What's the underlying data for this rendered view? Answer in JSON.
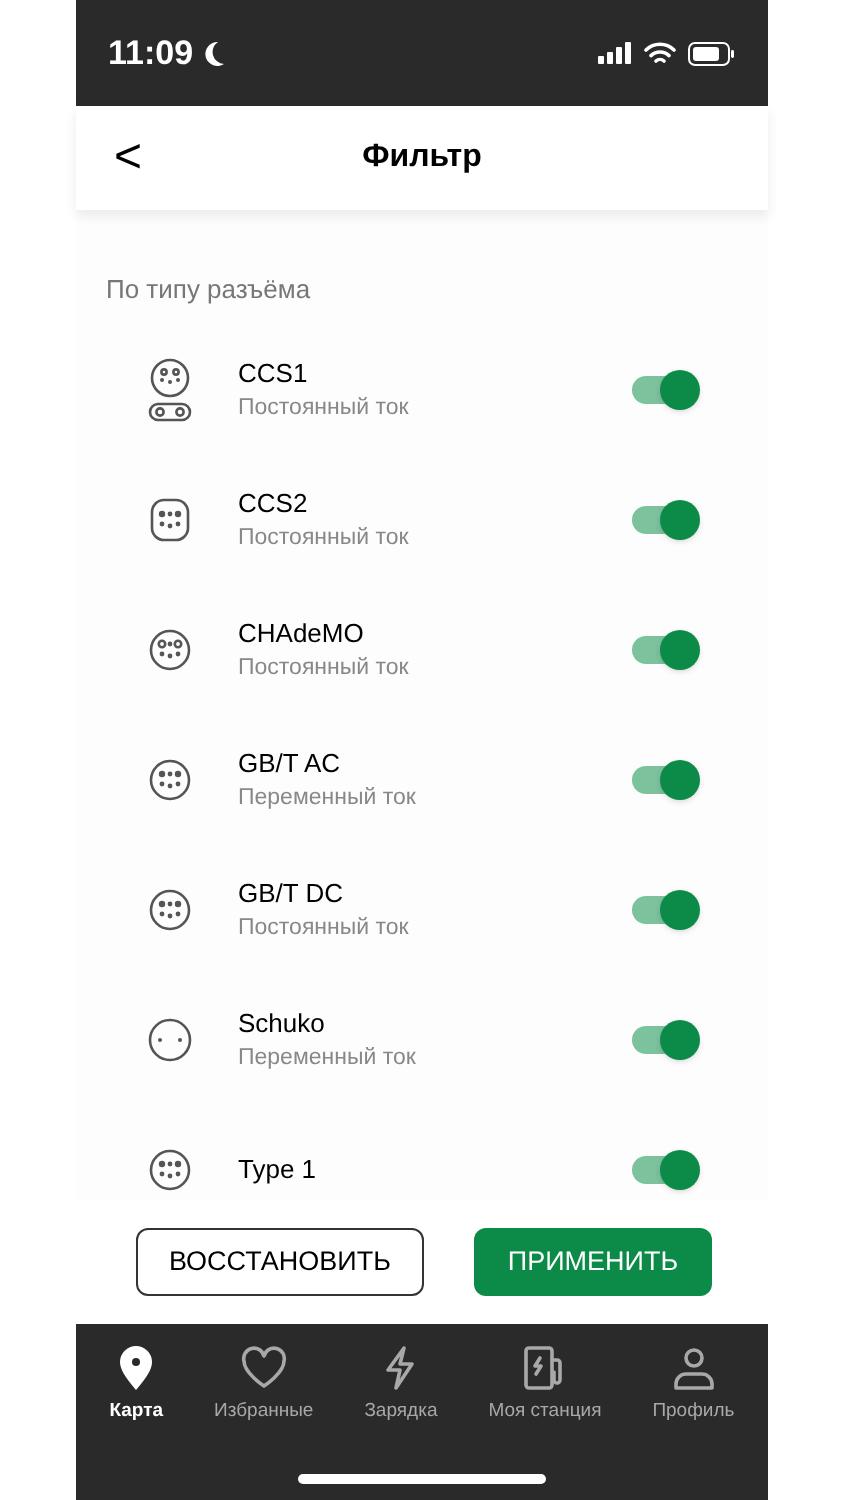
{
  "status_bar": {
    "time": "11:09"
  },
  "header": {
    "back": "<",
    "title": "Фильтр"
  },
  "section": {
    "title": "По типу разъёма"
  },
  "connectors": [
    {
      "name": "CCS1",
      "current": "Постоянный ток",
      "on": true
    },
    {
      "name": "CCS2",
      "current": "Постоянный ток",
      "on": true
    },
    {
      "name": "CHAdeMO",
      "current": "Постоянный ток",
      "on": true
    },
    {
      "name": "GB/T AC",
      "current": "Переменный ток",
      "on": true
    },
    {
      "name": "GB/T DC",
      "current": "Постоянный ток",
      "on": true
    },
    {
      "name": "Schuko",
      "current": "Переменный ток",
      "on": true
    },
    {
      "name": "Type 1",
      "on": true
    }
  ],
  "buttons": {
    "reset": "ВОССТАНОВИТЬ",
    "apply": "ПРИМЕНИТЬ"
  },
  "tab_bar": [
    {
      "label": "Карта",
      "kind": "map",
      "selected": true
    },
    {
      "label": "Избранные",
      "kind": "favorites",
      "selected": false
    },
    {
      "label": "Зарядка",
      "kind": "charging",
      "selected": false
    },
    {
      "label": "Моя станция",
      "kind": "station",
      "selected": false
    },
    {
      "label": "Профиль",
      "kind": "profile",
      "selected": false
    }
  ]
}
